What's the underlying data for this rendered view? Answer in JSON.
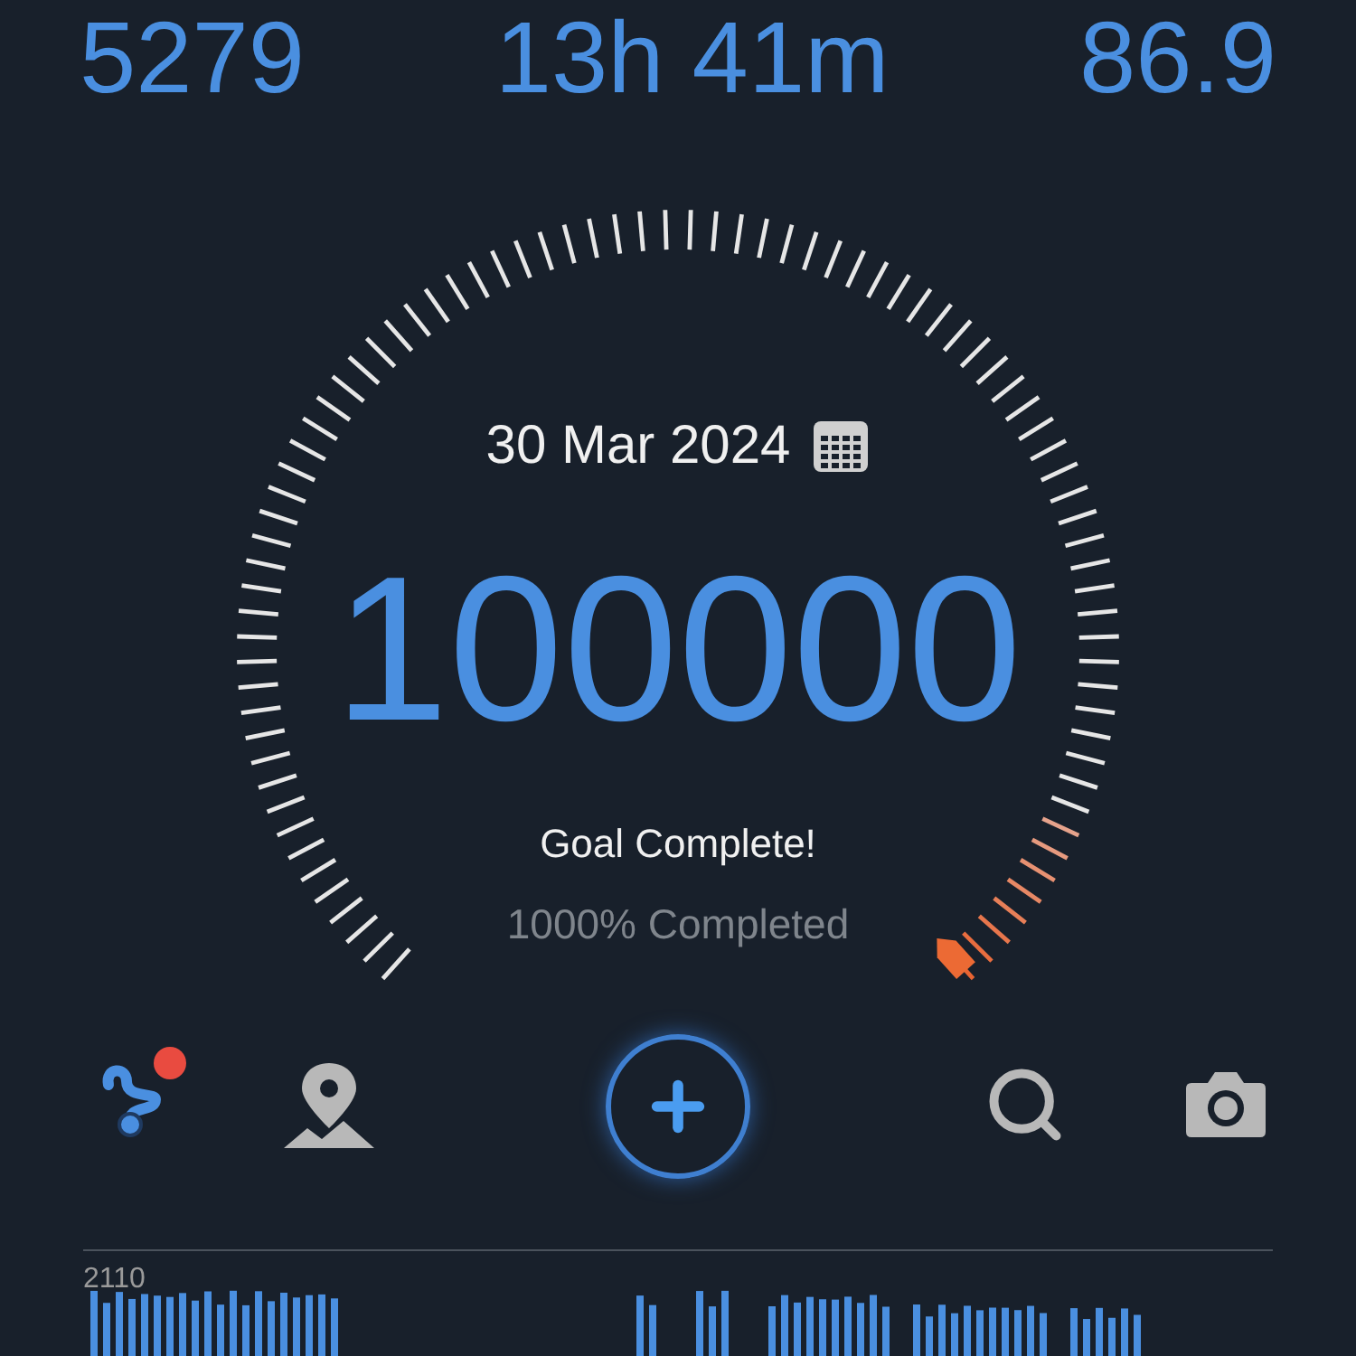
{
  "stats": [
    {
      "value": "5279"
    },
    {
      "value": "13h 41m"
    },
    {
      "value": "86.9"
    }
  ],
  "gauge": {
    "date": "30 Mar 2024",
    "value": "100000",
    "status": "Goal Complete!",
    "progress": "1000% Completed"
  },
  "toolbar": {
    "route_alert": true
  },
  "activity": {
    "label": "2110"
  }
}
